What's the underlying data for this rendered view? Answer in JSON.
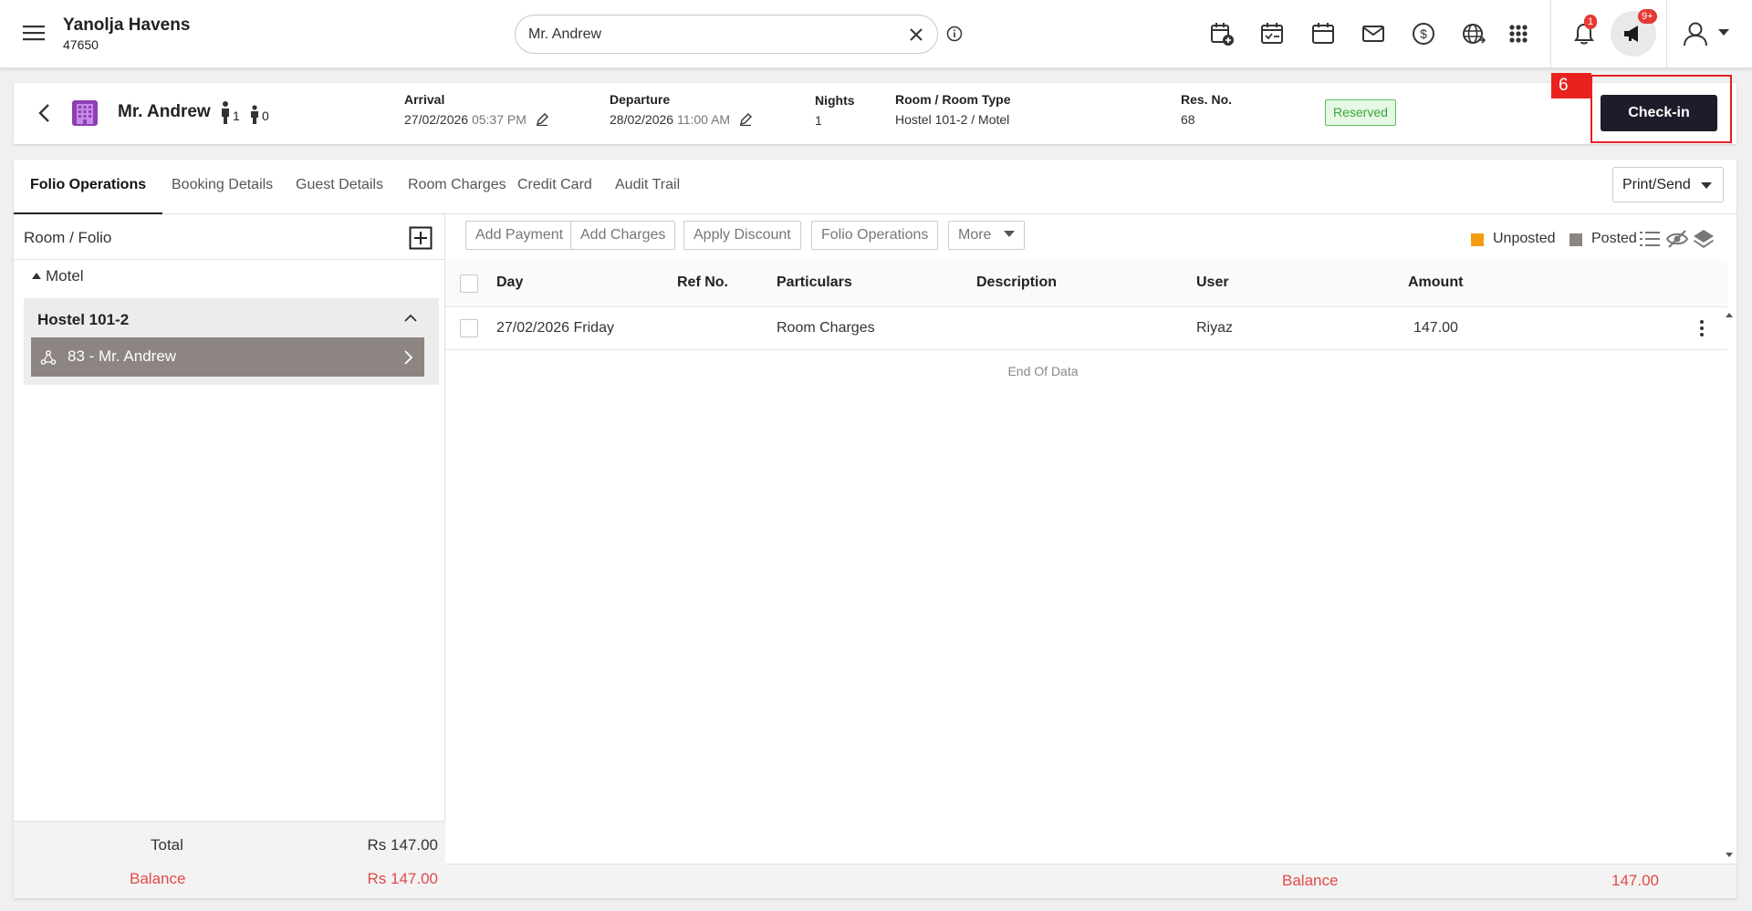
{
  "header": {
    "property_name": "Yanolja Havens",
    "property_code": "47650",
    "search_value": "Mr. Andrew",
    "notification_count": "1",
    "announcement_count": "9+",
    "icons": [
      "menu-icon",
      "calendar-add-icon",
      "calendar-check-icon",
      "calendar-icon",
      "mail-icon",
      "dollar-icon",
      "globe-icon",
      "apps-grid-icon",
      "bell-icon",
      "megaphone-icon",
      "user-icon"
    ]
  },
  "reservation": {
    "guest_name": "Mr. Andrew",
    "adults": "1",
    "children": "0",
    "arrival_label": "Arrival",
    "arrival_date": "27/02/2026",
    "arrival_time": "05:37 PM",
    "departure_label": "Departure",
    "departure_date": "28/02/2026",
    "departure_time": "11:00 AM",
    "nights_label": "Nights",
    "nights": "1",
    "room_label": "Room / Room Type",
    "room": "Hostel 101-2 / Motel",
    "resno_label": "Res. No.",
    "resno": "68",
    "status": "Reserved",
    "status_color": "#3aa63a",
    "step_number": "6",
    "checkin_label": "Check-in",
    "accent_color": "#1e1c2b"
  },
  "tabs": [
    {
      "label": "Folio Operations",
      "active": true
    },
    {
      "label": "Booking Details"
    },
    {
      "label": "Guest Details"
    },
    {
      "label": "Room Charges"
    },
    {
      "label": "Credit Card"
    },
    {
      "label": "Audit Trail"
    }
  ],
  "print_send_label": "Print/Send",
  "left_panel": {
    "title": "Room / Folio",
    "group": "Motel",
    "room": "Hostel 101-2",
    "folio": "83 - Mr. Andrew",
    "total_label": "Total",
    "total_value": "Rs 147.00",
    "balance_label": "Balance",
    "balance_value": "Rs 147.00"
  },
  "actions": {
    "add_payment": "Add Payment",
    "add_charges": "Add Charges",
    "apply_discount": "Apply Discount",
    "folio_operations": "Folio Operations",
    "more": "More"
  },
  "legend": {
    "unposted": "Unposted",
    "unposted_color": "#f39c12",
    "posted": "Posted",
    "posted_color": "#8c8582"
  },
  "table": {
    "columns": [
      "Day",
      "Ref No.",
      "Particulars",
      "Description",
      "User",
      "Amount"
    ],
    "rows": [
      {
        "day": "27/02/2026 Friday",
        "ref": "",
        "particulars": "Room Charges",
        "description": "",
        "user": "Riyaz",
        "amount": "147.00"
      }
    ],
    "end_text": "End Of Data"
  },
  "footer": {
    "balance_label": "Balance",
    "balance_value": "147.00"
  }
}
